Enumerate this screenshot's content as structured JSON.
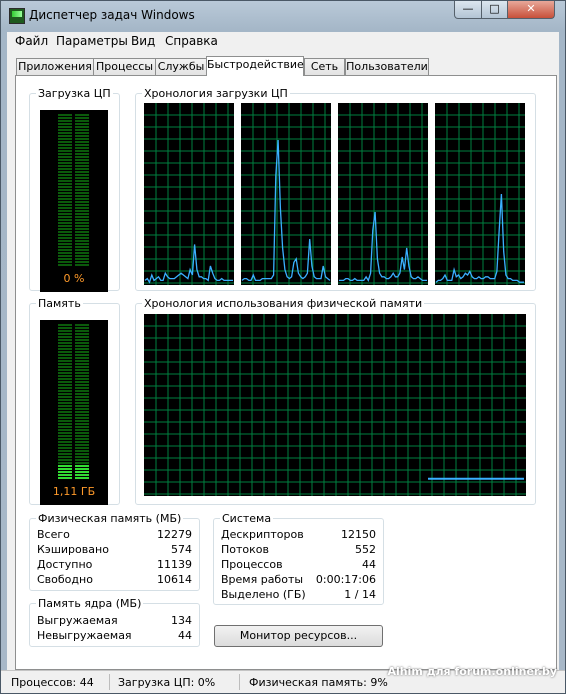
{
  "window": {
    "title": "Диспетчер задач Windows"
  },
  "controls": {
    "minimize": "—",
    "maximize": "□",
    "close": "✕"
  },
  "menu": [
    {
      "label": "Файл"
    },
    {
      "label": "Параметры"
    },
    {
      "label": "Вид"
    },
    {
      "label": "Справка"
    }
  ],
  "tabs": [
    {
      "label": "Приложения"
    },
    {
      "label": "Процессы"
    },
    {
      "label": "Службы"
    },
    {
      "label": "Быстродействие",
      "active": true
    },
    {
      "label": "Сеть"
    },
    {
      "label": "Пользователи"
    }
  ],
  "cpu": {
    "group_title": "Загрузка ЦП",
    "value_label": "0 %",
    "level": 0.0,
    "history_title": "Хронология загрузки ЦП",
    "core_histories": [
      [
        2,
        3,
        1,
        5,
        2,
        3,
        4,
        2,
        2,
        6,
        4,
        3,
        3,
        3,
        4,
        5,
        6,
        5,
        4,
        3,
        8,
        5,
        22,
        8,
        4,
        4,
        3,
        3,
        2,
        10,
        6,
        3,
        2,
        2,
        3,
        2,
        2,
        2,
        2,
        2
      ],
      [
        2,
        3,
        3,
        2,
        2,
        5,
        2,
        2,
        2,
        3,
        3,
        3,
        3,
        3,
        5,
        60,
        80,
        42,
        20,
        8,
        4,
        3,
        4,
        12,
        14,
        6,
        4,
        3,
        4,
        6,
        25,
        10,
        4,
        3,
        3,
        3,
        10,
        4,
        3,
        2
      ],
      [
        2,
        2,
        2,
        3,
        3,
        2,
        2,
        3,
        2,
        2,
        2,
        2,
        4,
        2,
        6,
        30,
        40,
        14,
        6,
        4,
        4,
        3,
        3,
        4,
        6,
        4,
        4,
        6,
        15,
        8,
        20,
        10,
        4,
        3,
        3,
        4,
        3,
        2,
        2,
        2
      ],
      [
        1,
        2,
        2,
        3,
        5,
        2,
        2,
        2,
        8,
        4,
        5,
        3,
        4,
        6,
        5,
        7,
        4,
        3,
        3,
        4,
        3,
        3,
        4,
        4,
        3,
        3,
        3,
        7,
        30,
        50,
        18,
        5,
        3,
        3,
        2,
        2,
        2,
        1,
        1,
        1
      ]
    ]
  },
  "memory": {
    "group_title": "Память",
    "value_label": "1,11 ГБ",
    "level": 0.09,
    "history_title": "Хронология использования физической памяти",
    "history": [
      9,
      9,
      9,
      9,
      9,
      9,
      9,
      9,
      9,
      9
    ]
  },
  "physical": {
    "title": "Физическая память (МБ)",
    "rows": [
      {
        "label": "Всего",
        "value": "12279"
      },
      {
        "label": "Кэшировано",
        "value": "574"
      },
      {
        "label": "Доступно",
        "value": "11139"
      },
      {
        "label": "Свободно",
        "value": "10614"
      }
    ]
  },
  "kernel": {
    "title": "Память ядра (МБ)",
    "rows": [
      {
        "label": "Выгружаемая",
        "value": "134"
      },
      {
        "label": "Невыгружаемая",
        "value": "44"
      }
    ]
  },
  "system": {
    "title": "Система",
    "rows": [
      {
        "label": "Дескрипторов",
        "value": "12150"
      },
      {
        "label": "Потоков",
        "value": "552"
      },
      {
        "label": "Процессов",
        "value": "44"
      },
      {
        "label": "Время работы",
        "value": "0:00:17:06"
      },
      {
        "label": "Выделено (ГБ)",
        "value": "1 / 14"
      }
    ]
  },
  "resource_button": "Монитор ресурсов...",
  "status": {
    "processes": "Процессов: 44",
    "cpu": "Загрузка ЦП: 0%",
    "memory": "Физическая память: 9%"
  },
  "watermark": "Alhim для forum.onliner.by",
  "colors": {
    "meter_green": "#33dd33",
    "graph_line": "#3ab0ff",
    "grid": "#008040"
  }
}
